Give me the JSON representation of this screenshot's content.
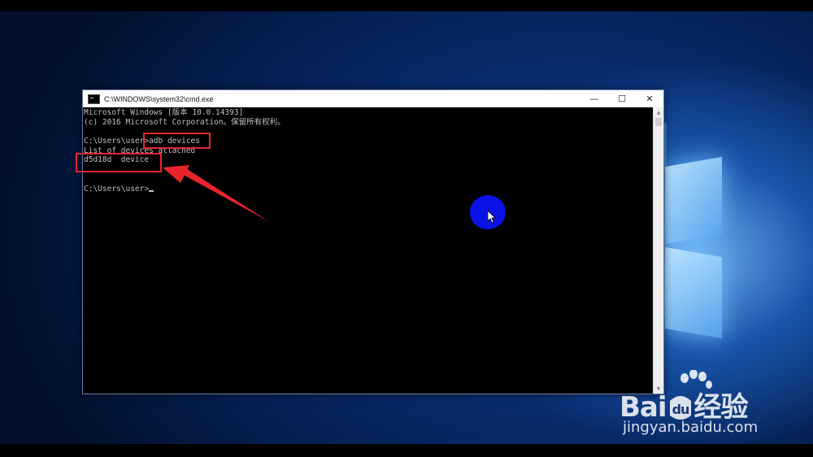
{
  "window": {
    "title": "C:\\WINDOWS\\system32\\cmd.exe",
    "minimize_label": "—",
    "maximize_label": "☐",
    "close_label": "✕"
  },
  "console": {
    "lines": [
      "Microsoft Windows [版本 10.0.14393]",
      "(c) 2016 Microsoft Corporation。保留所有权利。",
      "",
      "C:\\Users\\user>adb devices",
      "List of devices attached",
      "d5d18d  device",
      "",
      "",
      "C:\\Users\\user>"
    ]
  },
  "annotation": {
    "color": "#e8252b"
  },
  "watermark": {
    "logo_text_a": "Bai",
    "logo_text_b": "经验",
    "site": "jingyan.baidu.com"
  },
  "colors": {
    "console_text": "#c0c0c0",
    "click_indicator": "#0b12e6",
    "annotation": "#e8252b"
  }
}
